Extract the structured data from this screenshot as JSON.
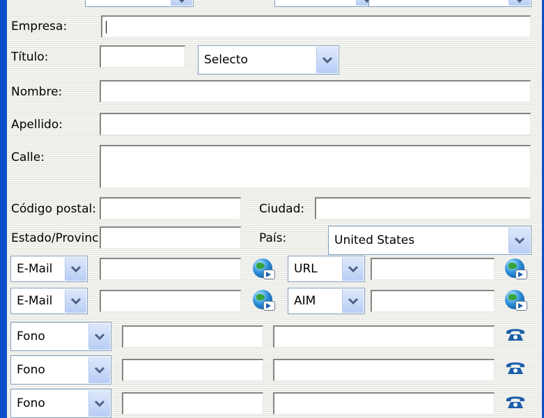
{
  "labels": {
    "empresa": "Empresa:",
    "titulo": "Título:",
    "nombre": "Nombre:",
    "apellido": "Apellido:",
    "calle": "Calle:",
    "codigo_postal": "Código postal:",
    "ciudad": "Ciudad:",
    "estado": "Estado/Provincia:",
    "pais": "País:"
  },
  "titulo_select": "Selecto",
  "pais_select": "United States",
  "contact_rows": [
    {
      "left_type": "E-Mail",
      "right_type": "URL"
    },
    {
      "left_type": "E-Mail",
      "right_type": "AIM"
    }
  ],
  "phone_rows": [
    {
      "type": "Fono"
    },
    {
      "type": "Fono"
    },
    {
      "type": "Fono"
    }
  ],
  "colors": {
    "frame": "#0a4fc9",
    "dropdown_button": "#c3d3f7",
    "phone_icon": "#1d5fa8"
  },
  "icons": {
    "globe": "globe-link-icon",
    "phone": "phone-icon",
    "dropdown": "chevron-down-icon"
  }
}
